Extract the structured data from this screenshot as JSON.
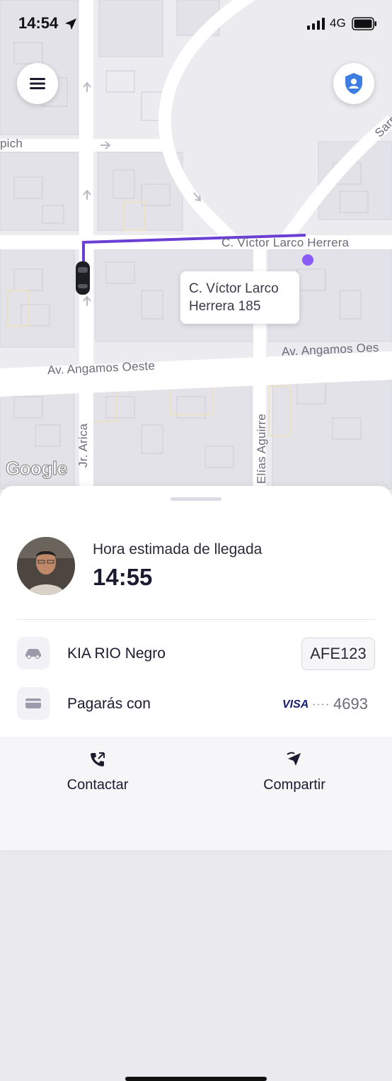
{
  "status_bar": {
    "time": "14:54",
    "network": "4G"
  },
  "map": {
    "streets": {
      "victor_larco": "C. Víctor Larco Herrera",
      "angamos_right": "Av. Angamos Oes",
      "angamos_left": "Av. Angamos Oeste",
      "arica": "Jr. Arica",
      "elias_aguirre": "Elías Aguirre",
      "pich": "pich",
      "sarr": "Sarr"
    },
    "destination_bubble": {
      "line1": "C. Víctor Larco",
      "line2": "Herrera 185"
    },
    "attribution": "Google",
    "route_color": "#6b3fd4",
    "destination_color": "#8a5cf6"
  },
  "buttons": {
    "menu_icon": "hamburger-menu-icon",
    "safety_icon": "shield-user-icon",
    "safety_color": "#3d7ee0"
  },
  "trip": {
    "eta_label": "Hora estimada de llegada",
    "eta_time": "14:55",
    "vehicle": "KIA RIO Negro",
    "plate": "AFE123",
    "payment_label": "Pagarás con",
    "card_brand": "VISA",
    "card_mask": "····",
    "card_last4": "4693"
  },
  "actions": {
    "contact": "Contactar",
    "share": "Compartir"
  }
}
